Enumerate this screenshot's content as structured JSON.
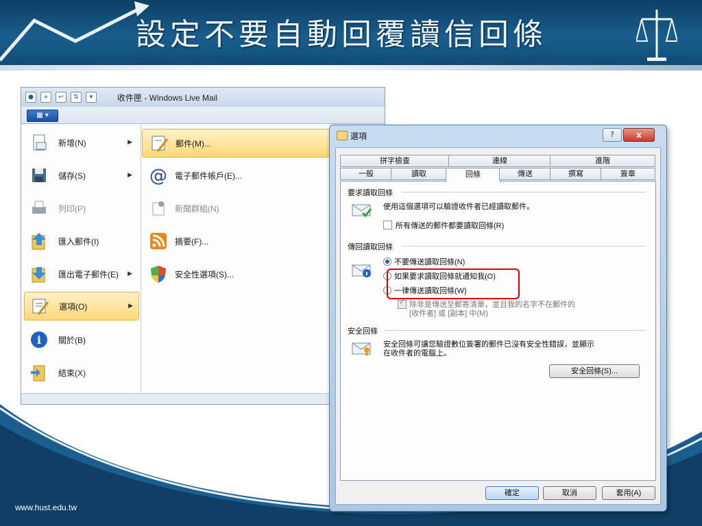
{
  "slide": {
    "title": "設定不要自動回覆讀信回條",
    "footer_url": "www.hust.edu.tw",
    "colors": {
      "header": "#1a5e8e",
      "title_text": "#eef6ff",
      "wave": "#1c5d8f"
    }
  },
  "wlm": {
    "title": "收件匣 - Windows Live Mail",
    "menu_button": "▾",
    "left_menu": [
      {
        "label": "新增(N)",
        "icon": "new-document-icon",
        "has_submenu": true,
        "disabled": false
      },
      {
        "label": "儲存(S)",
        "icon": "floppy-disk-icon",
        "has_submenu": true,
        "disabled": false
      },
      {
        "label": "列印(P)",
        "icon": "printer-icon",
        "has_submenu": false,
        "disabled": true
      },
      {
        "label": "匯入郵件(I)",
        "icon": "import-icon",
        "has_submenu": false,
        "disabled": false
      },
      {
        "label": "匯出電子郵件(E)",
        "icon": "export-icon",
        "has_submenu": true,
        "disabled": false
      },
      {
        "label": "選項(O)",
        "icon": "options-icon",
        "has_submenu": true,
        "disabled": false,
        "selected": true
      },
      {
        "label": "關於(B)",
        "icon": "info-icon",
        "has_submenu": false,
        "disabled": false
      },
      {
        "label": "結束(X)",
        "icon": "exit-icon",
        "has_submenu": false,
        "disabled": false
      }
    ],
    "right_menu": [
      {
        "label": "郵件(M)...",
        "icon": "mail-options-icon",
        "selected": true
      },
      {
        "label": "電子郵件帳戶(E)...",
        "icon": "at-sign-icon"
      },
      {
        "label": "新聞群組(N)",
        "icon": "newsgroup-icon",
        "disabled": true
      },
      {
        "label": "摘要(F)...",
        "icon": "rss-feed-icon"
      },
      {
        "label": "安全性選項(S)...",
        "icon": "shield-icon"
      }
    ]
  },
  "dialog": {
    "title": "選項",
    "help": "?",
    "close": "x",
    "tabs_top": [
      "拼字檢查",
      "連線",
      "進階"
    ],
    "tabs_bottom": [
      "一般",
      "讀取",
      "回條",
      "傳送",
      "撰寫",
      "簽章"
    ],
    "active_tab": "回條",
    "request": {
      "group": "要求讀取回條",
      "desc": "使用這個選項可以驗證收件者已經讀取郵件。",
      "checkbox": "所有傳送的郵件都要讀取回條(R)"
    },
    "return": {
      "group": "傳回讀取回條",
      "options": [
        "不要傳送讀取回條(N)",
        "如果要求讀取回條就通知我(O)",
        "一律傳送讀取回條(W)"
      ],
      "selected_index": 0,
      "sub_checkbox_line1": "除非是傳送至郵寄清單，並且我的名字不在郵件的",
      "sub_checkbox_line2": "[收件者] 或 [副本] 中(M)"
    },
    "secure": {
      "group": "安全回條",
      "desc_line1": "安全回條可讓您驗證數位簽署的郵件已沒有安全性錯誤，並顯示",
      "desc_line2": "在收件者的電腦上。",
      "button": "安全回條(S)..."
    },
    "buttons": {
      "ok": "確定",
      "cancel": "取消",
      "apply": "套用(A)"
    }
  }
}
